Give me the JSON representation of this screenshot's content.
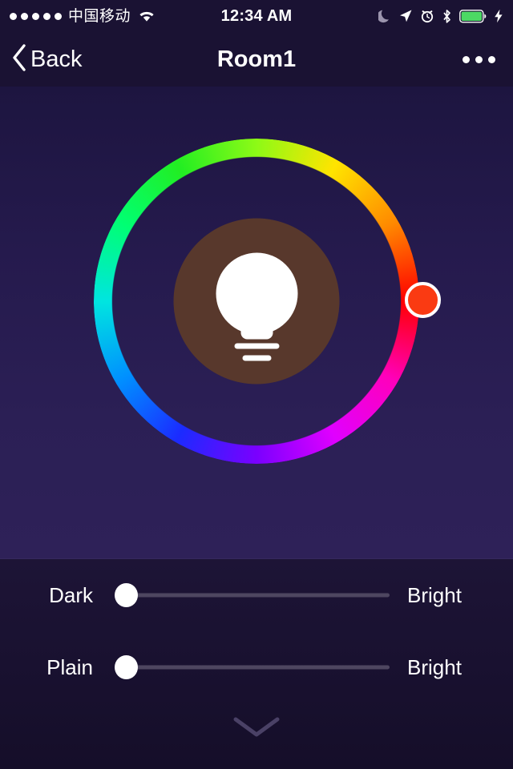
{
  "status_bar": {
    "signal_dots": 5,
    "signal_dots_filled": 5,
    "carrier": "中国移动",
    "wifi_icon": "wifi-icon",
    "time": "12:34 AM",
    "right_icons": [
      "moon-icon",
      "location-arrow-icon",
      "alarm-clock-icon",
      "bluetooth-icon",
      "battery-full-icon",
      "charging-bolt-icon"
    ],
    "battery_color": "#4cd964",
    "background": "#1a1233",
    "text_color": "#ffffff"
  },
  "nav_bar": {
    "back_icon": "chevron-left-icon",
    "back_label": "Back",
    "title": "Room1",
    "more_icon": "more-dots-icon",
    "background": "#1a1233"
  },
  "color_wheel": {
    "icon": "lightbulb-icon",
    "inner_disc_color": "#58382c",
    "thumb_color": "#fa3a12",
    "thumb_ring_color": "#ffffff",
    "selected_hue_degrees": 10,
    "ring_type": "hue-wheel"
  },
  "sliders": [
    {
      "name": "brightness-slider",
      "left_label": "Dark",
      "right_label": "Bright",
      "value": 0,
      "min": 0,
      "max": 100,
      "thumb_color": "#ffffff",
      "track_color": "#4e4660"
    },
    {
      "name": "saturation-slider",
      "left_label": "Plain",
      "right_label": "Bright",
      "value": 0,
      "min": 0,
      "max": 100,
      "thumb_color": "#ffffff",
      "track_color": "#4e4660"
    }
  ],
  "footer": {
    "expand_icon": "chevron-down-icon"
  },
  "theme": {
    "background_top": "#1d1540",
    "background_mid": "#2b1f55",
    "background_bottom": "#150e29",
    "accent": "#fa3a12"
  }
}
